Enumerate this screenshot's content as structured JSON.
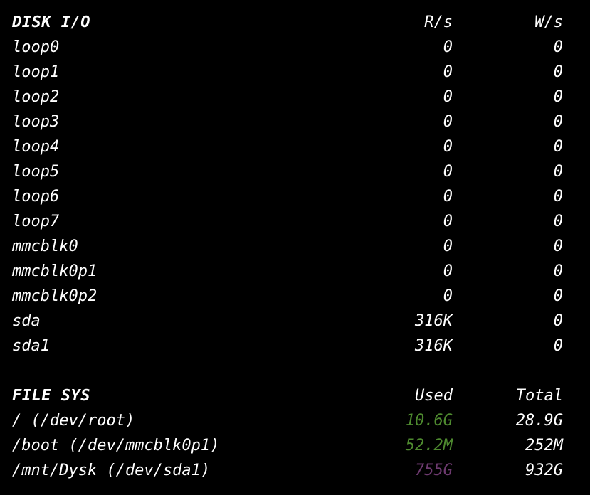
{
  "disk_io": {
    "title": "DISK I/O",
    "col_read": "R/s",
    "col_write": "W/s",
    "rows": [
      {
        "name": "loop0",
        "read": "0",
        "write": "0"
      },
      {
        "name": "loop1",
        "read": "0",
        "write": "0"
      },
      {
        "name": "loop2",
        "read": "0",
        "write": "0"
      },
      {
        "name": "loop3",
        "read": "0",
        "write": "0"
      },
      {
        "name": "loop4",
        "read": "0",
        "write": "0"
      },
      {
        "name": "loop5",
        "read": "0",
        "write": "0"
      },
      {
        "name": "loop6",
        "read": "0",
        "write": "0"
      },
      {
        "name": "loop7",
        "read": "0",
        "write": "0"
      },
      {
        "name": "mmcblk0",
        "read": "0",
        "write": "0"
      },
      {
        "name": "mmcblk0p1",
        "read": "0",
        "write": "0"
      },
      {
        "name": "mmcblk0p2",
        "read": "0",
        "write": "0"
      },
      {
        "name": "sda",
        "read": "316K",
        "write": "0"
      },
      {
        "name": "sda1",
        "read": "316K",
        "write": "0"
      }
    ]
  },
  "file_sys": {
    "title": "FILE SYS",
    "col_used": "Used",
    "col_total": "Total",
    "rows": [
      {
        "name": "/ (/dev/root)",
        "used": "10.6G",
        "total": "28.9G",
        "used_color": "#4e8a2f"
      },
      {
        "name": "/boot (/dev/mmcblk0p1)",
        "used": "52.2M",
        "total": "252M",
        "used_color": "#4e8a2f"
      },
      {
        "name": "/mnt/Dysk (/dev/sda1)",
        "used": "755G",
        "total": "932G",
        "used_color": "#6e3a70"
      }
    ]
  },
  "colors": {
    "background": "#000000",
    "text": "#ffffff",
    "used_ok": "#4e8a2f",
    "used_high": "#6e3a70"
  }
}
